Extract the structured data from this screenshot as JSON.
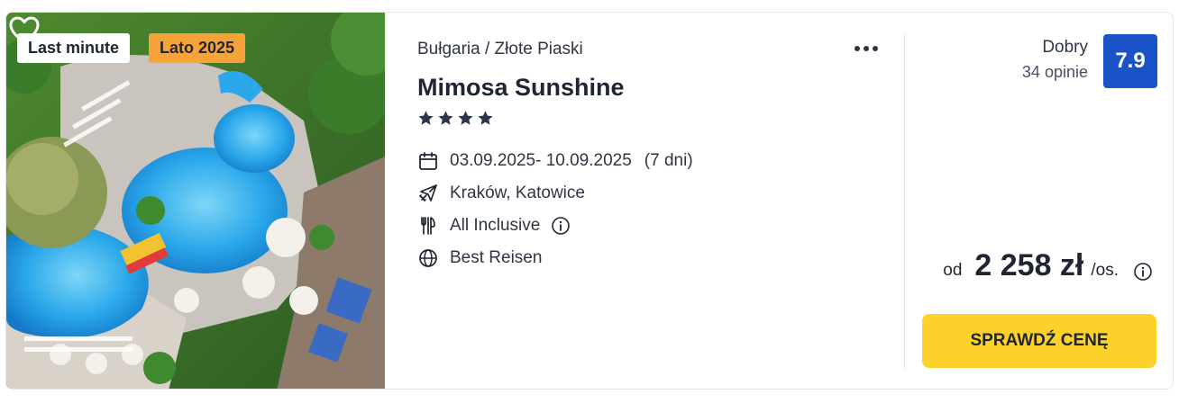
{
  "offer": {
    "badges": [
      "Last minute",
      "Lato 2025"
    ],
    "location": "Bułgaria / Złote Piaski",
    "hotel_name": "Mimosa Sunshine",
    "stars": 4,
    "dates": "03.09.2025- 10.09.2025",
    "duration": "(7 dni)",
    "departure": "Kraków, Katowice",
    "board": "All Inclusive",
    "operator": "Best Reisen"
  },
  "rating": {
    "label": "Dobry",
    "count": "34 opinie",
    "score": "7.9"
  },
  "price": {
    "prefix": "od",
    "value": "2 258 zł",
    "unit": "/os."
  },
  "cta_label": "SPRAWDŹ CENĘ",
  "colors": {
    "accent_yellow": "#fcd12a",
    "rating_blue": "#1a53c7",
    "badge_orange": "#f7a33a",
    "text_dark": "#1f2533"
  },
  "icons": {
    "favorite": "heart-outline-icon",
    "menu": "more-dots-icon",
    "dates": "calendar-icon",
    "departure": "plane-icon",
    "board": "cutlery-icon",
    "operator": "globe-icon",
    "info": "info-circle-icon",
    "star": "star-icon"
  }
}
